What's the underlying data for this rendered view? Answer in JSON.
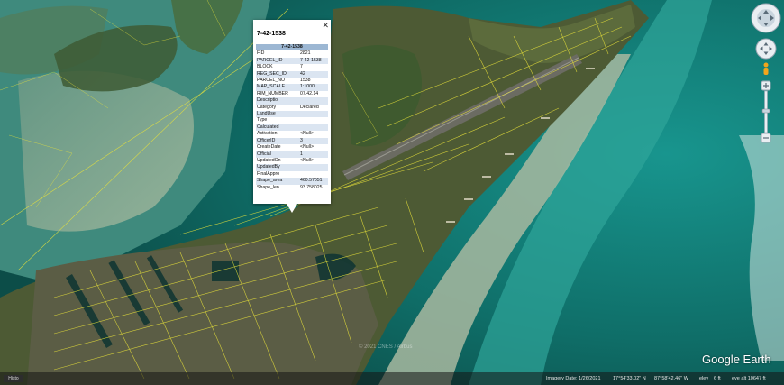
{
  "popup": {
    "title": "7-42-1538",
    "header": "7-42-1538",
    "close_icon": "close-icon",
    "rows": [
      {
        "key": "FID",
        "value": "2821"
      },
      {
        "key": "PARCEL_ID",
        "value": "7-42-1538"
      },
      {
        "key": "BLOCK",
        "value": "7"
      },
      {
        "key": "REG_SEC_ID",
        "value": "42"
      },
      {
        "key": "PARCEL_NO",
        "value": "1538"
      },
      {
        "key": "MAP_SCALE",
        "value": "1:1000"
      },
      {
        "key": "RIM_NUMBER",
        "value": "07.42.14"
      },
      {
        "key": "Descriptio",
        "value": ""
      },
      {
        "key": "Category",
        "value": "Declared"
      },
      {
        "key": "LandUse",
        "value": ""
      },
      {
        "key": "Type",
        "value": ""
      },
      {
        "key": "Calculated",
        "value": ""
      },
      {
        "key": "Activation",
        "value": "<Null>"
      },
      {
        "key": "OfficerID",
        "value": "3"
      },
      {
        "key": "CreateDate",
        "value": "<Null>"
      },
      {
        "key": "Official",
        "value": "1"
      },
      {
        "key": "UpdatedOn",
        "value": "<Null>"
      },
      {
        "key": "UpdatedBy",
        "value": ""
      },
      {
        "key": "FinalAppro",
        "value": ""
      },
      {
        "key": "Shape_area",
        "value": "460.57051"
      },
      {
        "key": "Shape_len",
        "value": "93.758025"
      }
    ]
  },
  "map": {
    "watermark": "© 2021 CNES / Airbus",
    "brand": "Google Earth",
    "colors": {
      "deep_water": "#0f5e5a",
      "shallow_water": "#a9bca0",
      "land": "#4d5a34",
      "parcel_lines": "#e8e23a"
    }
  },
  "status_bar": {
    "logo": "Histo",
    "imagery_date": "Imagery Date: 1/26/2021",
    "lat": "17°54'33.02\" N",
    "lon": "87°58'42.46\" W",
    "elev": "elev",
    "elev_val": "6 ft",
    "eye_alt": "eye alt 10647 ft"
  },
  "navigation": {
    "look_icon": "look-joystick-icon",
    "move_icon": "move-joystick-icon",
    "pegman_icon": "pegman-icon",
    "zoom_in_icon": "zoom-in-icon",
    "zoom_out_icon": "zoom-out-icon"
  }
}
